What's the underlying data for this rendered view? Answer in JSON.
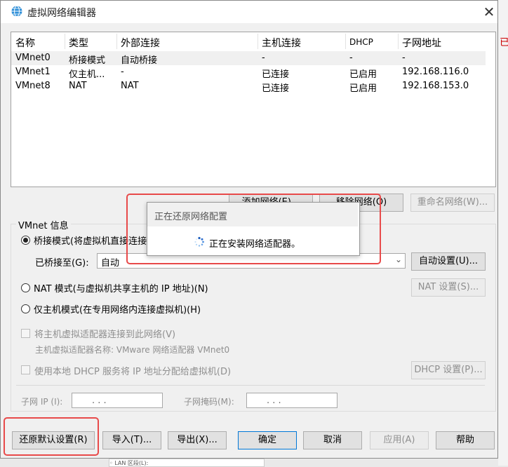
{
  "window": {
    "title": "虚拟网络编辑器",
    "close_symbol": "✕"
  },
  "table": {
    "headers": [
      "名称",
      "类型",
      "外部连接",
      "主机连接",
      "DHCP",
      "子网地址"
    ],
    "rows": [
      [
        "VMnet0",
        "桥接模式",
        "自动桥接",
        "-",
        "-",
        "-"
      ],
      [
        "VMnet1",
        "仅主机...",
        "-",
        "已连接",
        "已启用",
        "192.168.116.0"
      ],
      [
        "VMnet8",
        "NAT",
        "NAT",
        "已连接",
        "已启用",
        "192.168.153.0"
      ]
    ]
  },
  "list_buttons": {
    "add": "添加网络(E)...",
    "remove": "移除网络(O)",
    "rename": "重命名网络(W)..."
  },
  "vmnet_info": {
    "group_label": "VMnet 信息",
    "bridged_label": "桥接模式(将虚拟机直接连接到外部网络)(B)",
    "bridged_to_label": "已桥接至(G):",
    "bridged_to_value": "自动",
    "auto_settings": "自动设置(U)...",
    "nat_label": "NAT 模式(与虚拟机共享主机的 IP 地址)(N)",
    "nat_settings": "NAT 设置(S)...",
    "host_only_label": "仅主机模式(在专用网络内连接虚拟机)(H)",
    "connect_adapter_label": "将主机虚拟适配器连接到此网络(V)",
    "adapter_name_label": "主机虚拟适配器名称: VMware 网络适配器 VMnet0",
    "dhcp_label": "使用本地 DHCP 服务将 IP 地址分配给虚拟机(D)",
    "dhcp_settings": "DHCP 设置(P)...",
    "subnet_ip_label": "子网 IP (I):",
    "subnet_mask_label": "子网掩码(M):",
    "ip_dots": ".   .   ."
  },
  "bottom_buttons": {
    "restore": "还原默认设置(R)",
    "import": "导入(T)...",
    "export": "导出(X)...",
    "ok": "确定",
    "cancel": "取消",
    "apply": "应用(A)",
    "help": "帮助"
  },
  "progress": {
    "title": "正在还原网络配置",
    "message": "正在安装网络适配器。"
  },
  "background": {
    "side_text": "已",
    "bottom_text": "◦ LAN 区段(L):"
  },
  "colors": {
    "highlight": "#e84a4a",
    "accent": "#0078d7",
    "selected_row": "#f0f0f0"
  }
}
